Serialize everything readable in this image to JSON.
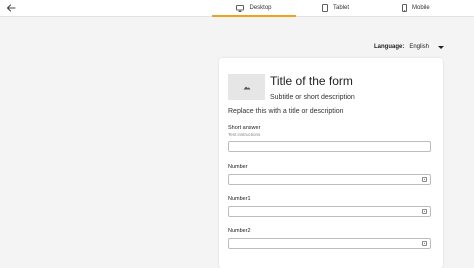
{
  "tabs": [
    {
      "label": "Desktop",
      "icon": "monitor-icon",
      "active": true
    },
    {
      "label": "Tablet",
      "icon": "tablet-icon",
      "active": false
    },
    {
      "label": "Mobile",
      "icon": "phone-icon",
      "active": false
    }
  ],
  "accent_color": "#f2a21a",
  "language": {
    "label": "Language:",
    "value": "English"
  },
  "form": {
    "title": "Title of the form",
    "subtitle": "Subtitle or short description",
    "description": "Replace this with a title or description",
    "fields": [
      {
        "label": "Short answer",
        "hint": "Test instructions",
        "type": "text",
        "value": ""
      },
      {
        "label": "Number",
        "type": "number",
        "value": ""
      },
      {
        "label": "Number1",
        "type": "number",
        "value": ""
      },
      {
        "label": "Number2",
        "type": "number",
        "value": ""
      }
    ]
  }
}
